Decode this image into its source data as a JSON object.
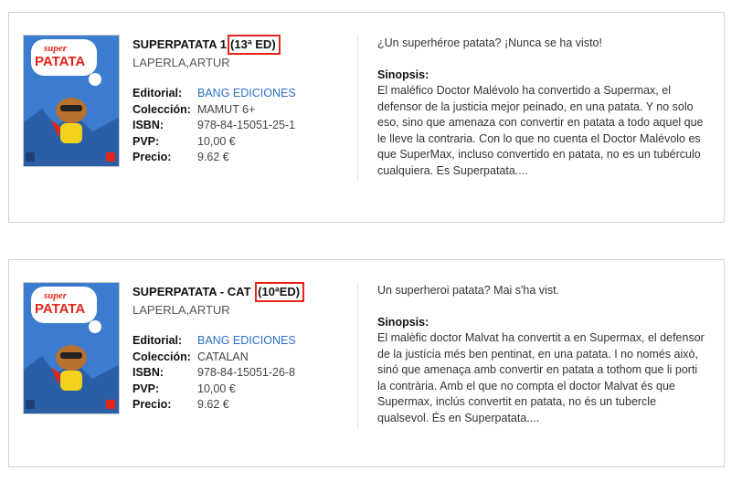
{
  "books": [
    {
      "title": "SUPERPATATA 1",
      "edition": "(13ª ED)",
      "author": "LAPERLA,ARTUR",
      "cover_label": {
        "super": "super",
        "patata": "PATATA"
      },
      "fields": {
        "editorial_label": "Editorial:",
        "editorial": "BANG EDICIONES",
        "coleccion_label": "Colección:",
        "coleccion": "MAMUT 6+",
        "isbn_label": "ISBN:",
        "isbn": "978-84-15051-25-1",
        "pvp_label": "PVP:",
        "pvp": "10,00 €",
        "precio_label": "Precio:",
        "precio": "9.62 €"
      },
      "tagline": "¿Un superhéroe patata? ¡Nunca se ha visto!",
      "sinopsis_label": "Sinopsis:",
      "sinopsis": "El maléfico Doctor Malévolo ha convertido a Supermax, el defensor de la justicia mejor peinado, en una patata. Y no solo eso, sino que amenaza con convertir en patata a todo aquel que le lleve la contraria. Con lo que no cuenta el Doctor Malévolo es que SuperMax, incluso convertido en patata, no es un tubérculo cualquiera. Es Superpatata...."
    },
    {
      "title": "SUPERPATATA - CAT",
      "edition": "(10ªED)",
      "author": "LAPERLA,ARTUR",
      "cover_label": {
        "super": "super",
        "patata": "PATATA"
      },
      "fields": {
        "editorial_label": "Editorial:",
        "editorial": "BANG EDICIONES",
        "coleccion_label": "Colección:",
        "coleccion": "CATALAN",
        "isbn_label": "ISBN:",
        "isbn": "978-84-15051-26-8",
        "pvp_label": "PVP:",
        "pvp": "10,00 €",
        "precio_label": "Precio:",
        "precio": "9.62 €"
      },
      "tagline": "Un superheroi patata? Mai s'ha vist.",
      "sinopsis_label": "Sinopsis:",
      "sinopsis": "El malèfic doctor Malvat ha convertit a en Supermax, el defensor de la justícia més ben pentinat, en una patata. I no només això, sinó que amenaça amb convertir en patata a tothom que li porti la contrària. Amb el que no compta el doctor Malvat és que Supermax, inclús convertit en patata, no és un tubercle qualsevol. És en Superpatata...."
    }
  ],
  "colors": {
    "highlight_box": "#e4251b",
    "link": "#2a6fc9",
    "cover_bg": "#3b7bd0"
  }
}
